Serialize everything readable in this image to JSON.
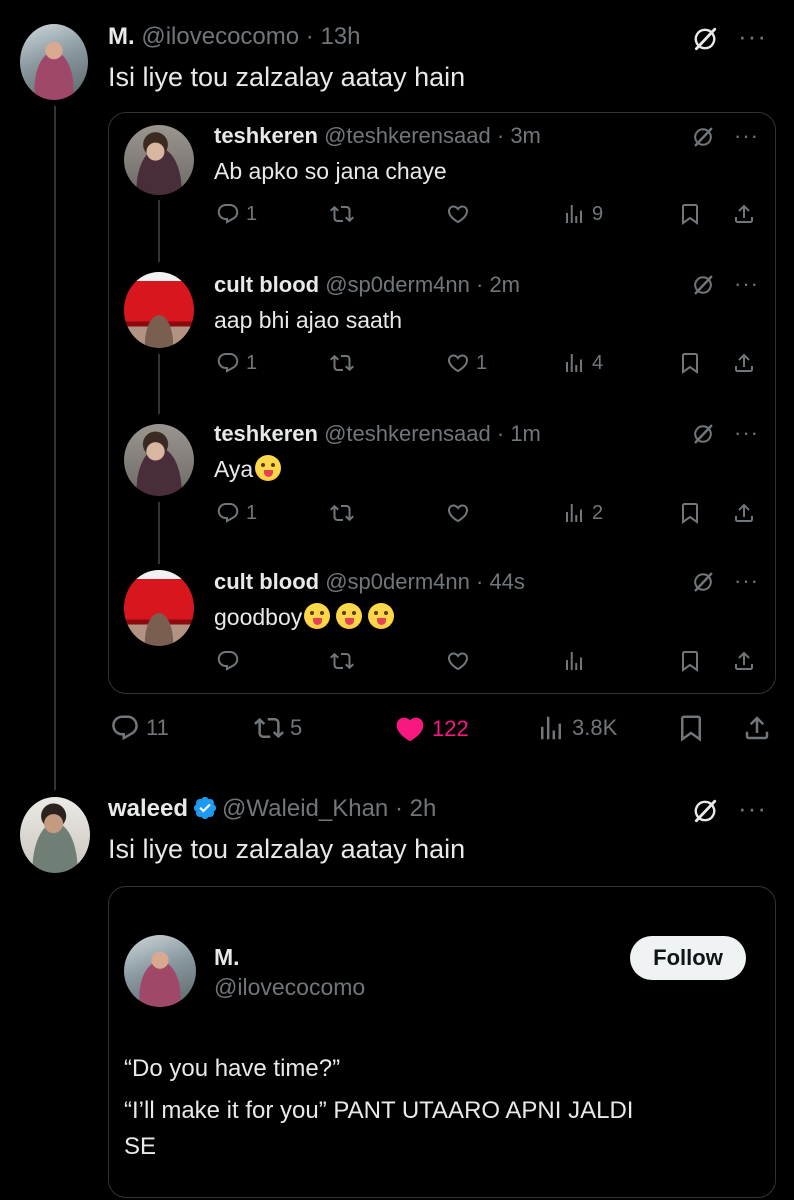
{
  "main_post": {
    "name": "M.",
    "handle": "@ilovecocomo",
    "time": "13h",
    "text": "Isi liye tou zalzalay aatay hain",
    "stats": {
      "replies": "11",
      "reposts": "5",
      "likes": "122",
      "views": "3.8K"
    }
  },
  "thread": [
    {
      "name": "teshkeren",
      "handle": "@teshkerensaad",
      "time": "3m",
      "text": "Ab apko so jana chaye",
      "replies": "1",
      "reposts": "",
      "likes": "",
      "views": "9",
      "emojis": []
    },
    {
      "name": "cult blood",
      "handle": "@sp0derm4nn",
      "time": "2m",
      "text": "aap bhi ajao saath",
      "replies": "1",
      "reposts": "",
      "likes": "1",
      "views": "4",
      "emojis": []
    },
    {
      "name": "teshkeren",
      "handle": "@teshkerensaad",
      "time": "1m",
      "text": "Aya",
      "replies": "1",
      "reposts": "",
      "likes": "",
      "views": "2",
      "emojis": [
        "yum-emoji"
      ]
    },
    {
      "name": "cult blood",
      "handle": "@sp0derm4nn",
      "time": "44s",
      "text": "goodboy",
      "replies": "",
      "reposts": "",
      "likes": "",
      "views": "",
      "emojis": [
        "tongue-emoji",
        "wink-emoji",
        "tongue-emoji"
      ]
    }
  ],
  "second_post": {
    "name": "waleed",
    "handle": "@Waleid_Khan",
    "time": "2h",
    "text": "Isi liye tou zalzalay aatay hain",
    "embed": {
      "name": "M.",
      "handle": "@ilovecocomo",
      "follow_label": "Follow",
      "line1": "“Do you have time?”",
      "line2": "“I’ll make it for you” PANT UTAARO APNI JALDI",
      "line3": "SE"
    }
  },
  "separator": "·",
  "colors": {
    "background": "#000000",
    "text": "#e7e9ea",
    "muted": "#71767b",
    "like": "#f91880",
    "verified": "#1d9bf0",
    "border": "#2f3336"
  }
}
